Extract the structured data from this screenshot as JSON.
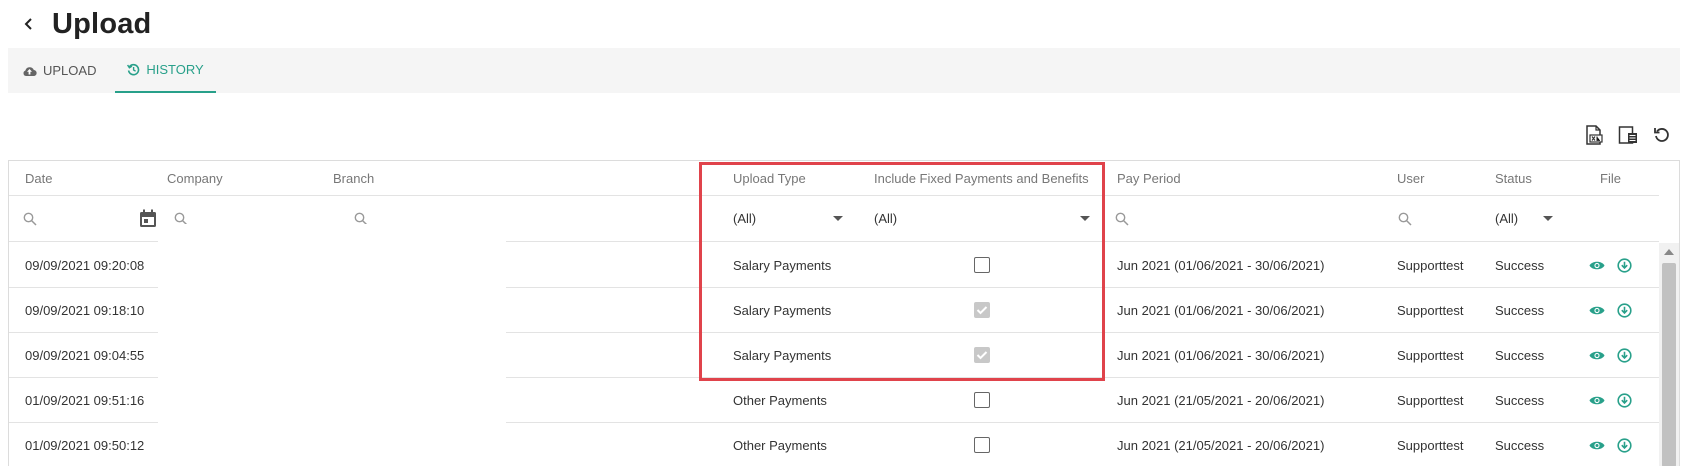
{
  "header": {
    "title": "Upload",
    "back_icon": "chevron-left-icon"
  },
  "tabs": [
    {
      "label": "UPLOAD",
      "icon": "cloud-upload-icon",
      "active": false
    },
    {
      "label": "HISTORY",
      "icon": "history-icon",
      "active": true
    }
  ],
  "toolbar": [
    {
      "icon": "export-excel-icon"
    },
    {
      "icon": "column-chooser-icon"
    },
    {
      "icon": "refresh-icon"
    }
  ],
  "colors": {
    "accent": "#28a08a",
    "highlight": "#e0434b"
  },
  "grid": {
    "columns": [
      "Date",
      "Company",
      "Branch",
      "Upload Type",
      "Include Fixed Payments and Benefits",
      "Pay Period",
      "User",
      "Status",
      "File"
    ],
    "filters": {
      "upload_type": "(All)",
      "include_fixed": "(All)",
      "status": "(All)"
    },
    "rows": [
      {
        "date": "09/09/2021 09:20:08",
        "upload_type": "Salary Payments",
        "include_fixed": false,
        "pay_period": "Jun 2021 (01/06/2021 - 30/06/2021)",
        "user": "Supporttest",
        "status": "Success"
      },
      {
        "date": "09/09/2021 09:18:10",
        "upload_type": "Salary Payments",
        "include_fixed": true,
        "pay_period": "Jun 2021 (01/06/2021 - 30/06/2021)",
        "user": "Supporttest",
        "status": "Success"
      },
      {
        "date": "09/09/2021 09:04:55",
        "upload_type": "Salary Payments",
        "include_fixed": true,
        "pay_period": "Jun 2021 (01/06/2021 - 30/06/2021)",
        "user": "Supporttest",
        "status": "Success"
      },
      {
        "date": "01/09/2021 09:51:16",
        "upload_type": "Other Payments",
        "include_fixed": false,
        "pay_period": "Jun 2021 (21/05/2021 - 20/06/2021)",
        "user": "Supporttest",
        "status": "Success"
      },
      {
        "date": "01/09/2021 09:50:12",
        "upload_type": "Other Payments",
        "include_fixed": false,
        "pay_period": "Jun 2021 (21/05/2021 - 20/06/2021)",
        "user": "Supporttest",
        "status": "Success"
      }
    ]
  }
}
